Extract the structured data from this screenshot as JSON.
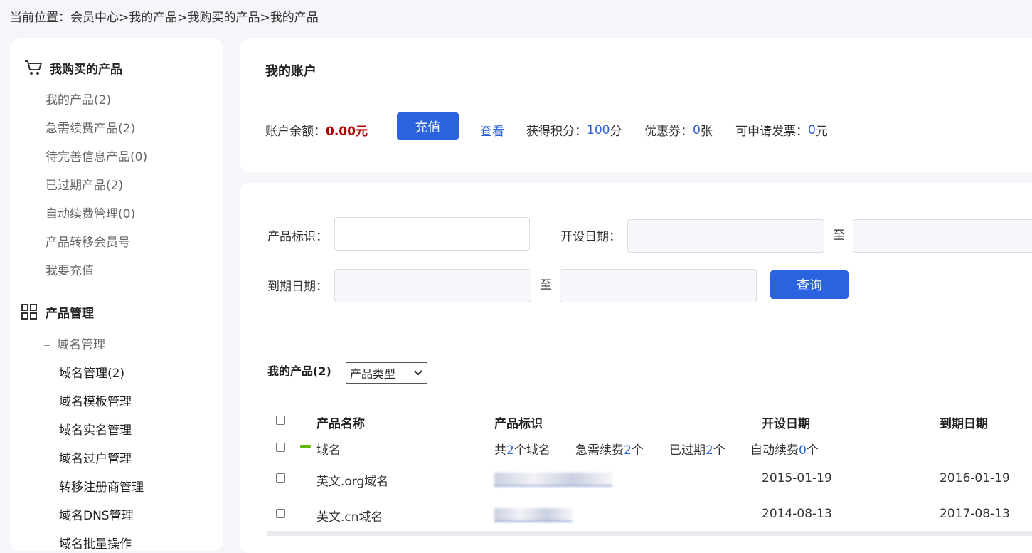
{
  "breadcrumb": "当前位置：会员中心>我的产品>我购买的产品>我的产品",
  "sidebar": {
    "section1": {
      "title": "我购买的产品",
      "icon": "cart-icon",
      "items": [
        "我的产品(2)",
        "急需续费产品(2)",
        "待完善信息产品(0)",
        "已过期产品(2)",
        "自动续费管理(0)",
        "产品转移会员号",
        "我要充值"
      ]
    },
    "section2": {
      "title": "产品管理",
      "icon": "grid-icon",
      "subgroup": "域名管理",
      "items": [
        "域名管理(2)",
        "域名模板管理",
        "域名实名管理",
        "域名过户管理",
        "转移注册商管理",
        "域名DNS管理",
        "域名批量操作"
      ]
    }
  },
  "account": {
    "title": "我的账户",
    "balance_label": "账户余额：",
    "balance_value": "0.00元",
    "recharge_button": "充值",
    "view_link": "查看",
    "points_label": "获得积分：",
    "points_value": "100",
    "points_unit": "分",
    "coupon_label": "优惠券：",
    "coupon_value": "0",
    "coupon_unit": "张",
    "invoice_label": "可申请发票：",
    "invoice_value": "0",
    "invoice_unit": "元"
  },
  "filters": {
    "product_id_label": "产品标识：",
    "open_date_label": "开设日期：",
    "to_label": "至",
    "expire_date_label": "到期日期：",
    "query_button": "查询"
  },
  "products": {
    "title": "我的产品(2)",
    "type_select": "产品类型",
    "columns": [
      "产品名称",
      "产品标识",
      "开设日期",
      "到期日期"
    ],
    "group": {
      "name": "域名",
      "total_prefix": "共",
      "total": "2",
      "total_suffix": "个域名",
      "urgent_prefix": "急需续费",
      "urgent": "2",
      "urgent_suffix": "个",
      "expired_prefix": "已过期",
      "expired": "2",
      "expired_suffix": "个",
      "auto_prefix": "自动续费",
      "auto": "0",
      "auto_suffix": "个"
    },
    "rows": [
      {
        "name": "英文.org域名",
        "open": "2015-01-19",
        "expire": "2016-01-19"
      },
      {
        "name": "英文.cn域名",
        "open": "2014-08-13",
        "expire": "2017-08-13"
      }
    ]
  }
}
